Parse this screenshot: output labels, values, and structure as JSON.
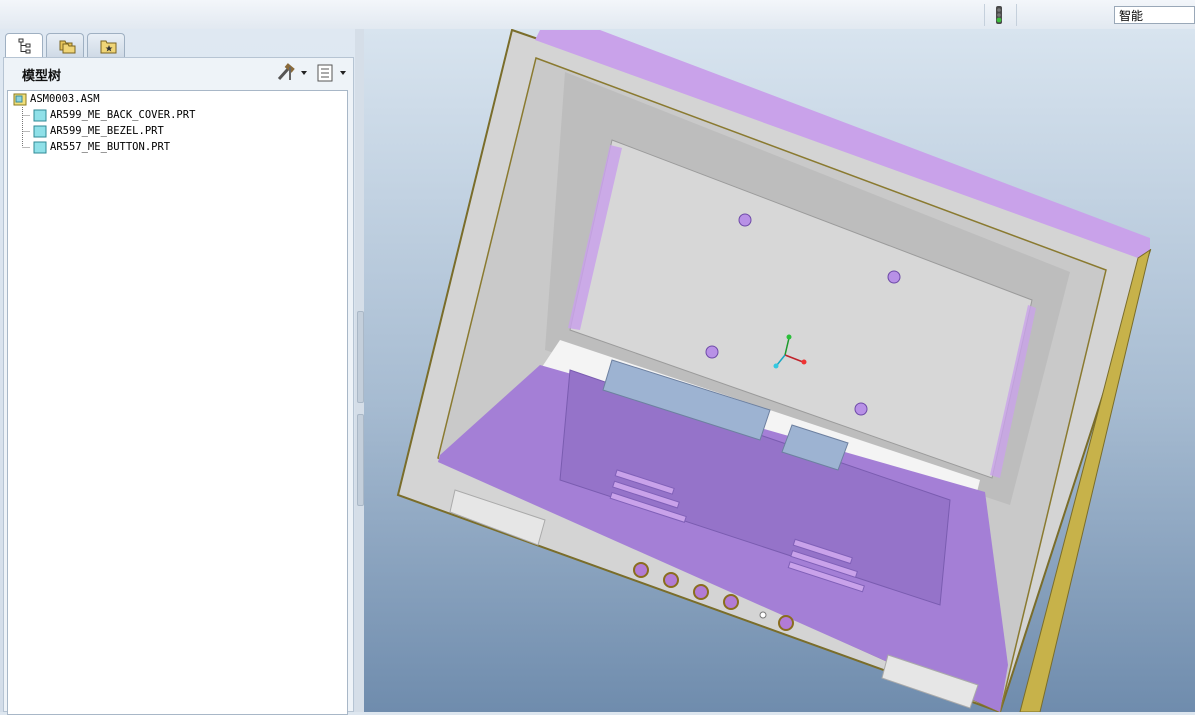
{
  "toolbar": {
    "filter_value": "智能",
    "signal_icon": "traffic-light-icon"
  },
  "navigator": {
    "tabs": [
      {
        "icon": "model-tree-icon",
        "active": true
      },
      {
        "icon": "folder-browser-icon",
        "active": false
      },
      {
        "icon": "favorites-icon",
        "active": false
      }
    ],
    "title": "模型树",
    "settings_icon": "tree-settings-icon",
    "show_icon": "tree-show-icon"
  },
  "model_tree": {
    "root": {
      "label": "ASM0003.ASM",
      "icon": "assembly-icon"
    },
    "children": [
      {
        "label": "AR599_ME_BACK_COVER.PRT",
        "icon": "part-icon"
      },
      {
        "label": "AR599_ME_BEZEL.PRT",
        "icon": "part-icon"
      },
      {
        "label": "AR557_ME_BUTTON.PRT",
        "icon": "part-icon"
      }
    ]
  },
  "colors": {
    "part_gray": "#d3d3d3",
    "part_purple": "#a07ed6",
    "edge_yellow": "#b9a23a",
    "background_top": "#d8e4ef",
    "background_bottom": "#6f8cad"
  }
}
